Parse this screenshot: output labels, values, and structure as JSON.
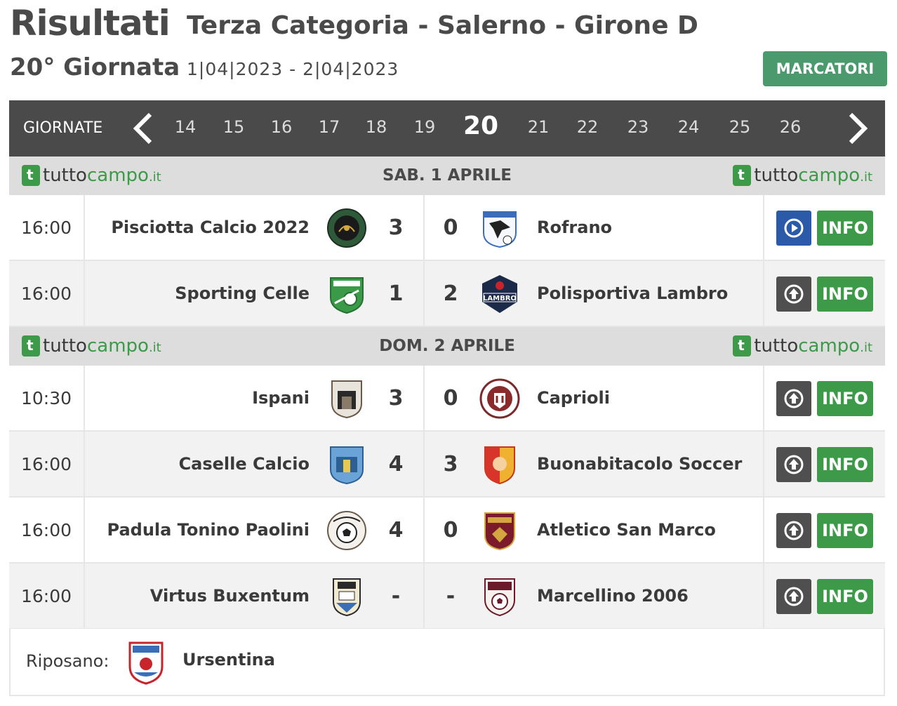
{
  "header": {
    "title": "Risultati",
    "subtitle": "Terza Categoria - Salerno - Girone D",
    "round": "20° Giornata",
    "dates": "1|04|2023 - 2|04|2023",
    "marcatori_label": "MARCATORI",
    "marcatori_color": "#4a9a6e"
  },
  "nav": {
    "label": "GIORNATE",
    "prev_icon": "chevron-left-icon",
    "next_icon": "chevron-right-icon",
    "rounds": [
      "14",
      "15",
      "16",
      "17",
      "18",
      "19",
      "20",
      "21",
      "22",
      "23",
      "24",
      "25",
      "26"
    ],
    "active": "20"
  },
  "brand": {
    "part1": "tutto",
    "part2": "campo",
    "suffix": ".it",
    "color": "#3c9a48"
  },
  "days": [
    {
      "label": "SAB. 1 APRILE",
      "matches": [
        {
          "time": "16:00",
          "home": "Pisciotta Calcio 2022",
          "home_score": "3",
          "away_score": "0",
          "away": "Rofrano",
          "action_icon": "play-icon",
          "info": "INFO"
        },
        {
          "time": "16:00",
          "home": "Sporting Celle",
          "home_score": "1",
          "away_score": "2",
          "away": "Polisportiva Lambro",
          "action_icon": "arrow-up-icon",
          "info": "INFO"
        }
      ]
    },
    {
      "label": "DOM. 2 APRILE",
      "matches": [
        {
          "time": "10:30",
          "home": "Ispani",
          "home_score": "3",
          "away_score": "0",
          "away": "Caprioli",
          "action_icon": "arrow-up-icon",
          "info": "INFO"
        },
        {
          "time": "16:00",
          "home": "Caselle Calcio",
          "home_score": "4",
          "away_score": "3",
          "away": "Buonabitacolo Soccer",
          "action_icon": "arrow-up-icon",
          "info": "INFO"
        },
        {
          "time": "16:00",
          "home": "Padula Tonino Paolini",
          "home_score": "4",
          "away_score": "0",
          "away": "Atletico San Marco",
          "action_icon": "arrow-up-icon",
          "info": "INFO"
        },
        {
          "time": "16:00",
          "home": "Virtus Buxentum",
          "home_score": "-",
          "away_score": "-",
          "away": "Marcellino 2006",
          "action_icon": "arrow-up-icon",
          "info": "INFO"
        }
      ]
    }
  ],
  "rest": {
    "label": "Riposano:",
    "team": "Ursentina"
  },
  "colors": {
    "info_green": "#3c9a48",
    "play_blue": "#2b5ba8",
    "nav_bg": "#4a4a4a"
  }
}
